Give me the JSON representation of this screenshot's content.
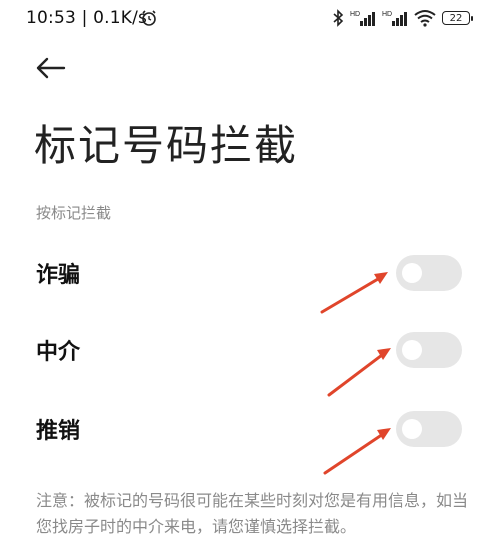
{
  "status_bar": {
    "time_speed": "10:53 | 0.1K/s",
    "signal1_label": "HD",
    "signal2_label": "HD",
    "battery_level": "22"
  },
  "page": {
    "title": "标记号码拦截"
  },
  "section": {
    "header": "按标记拦截"
  },
  "settings": [
    {
      "label": "诈骗",
      "enabled": false
    },
    {
      "label": "中介",
      "enabled": false
    },
    {
      "label": "推销",
      "enabled": false
    }
  ],
  "notice": "注意：被标记的号码很可能在某些时刻对您是有用信息，如当您找房子时的中介来电，请您谨慎选择拦截。",
  "colors": {
    "annotation_arrow": "#e0452b",
    "toggle_off": "#e6e6e6"
  }
}
